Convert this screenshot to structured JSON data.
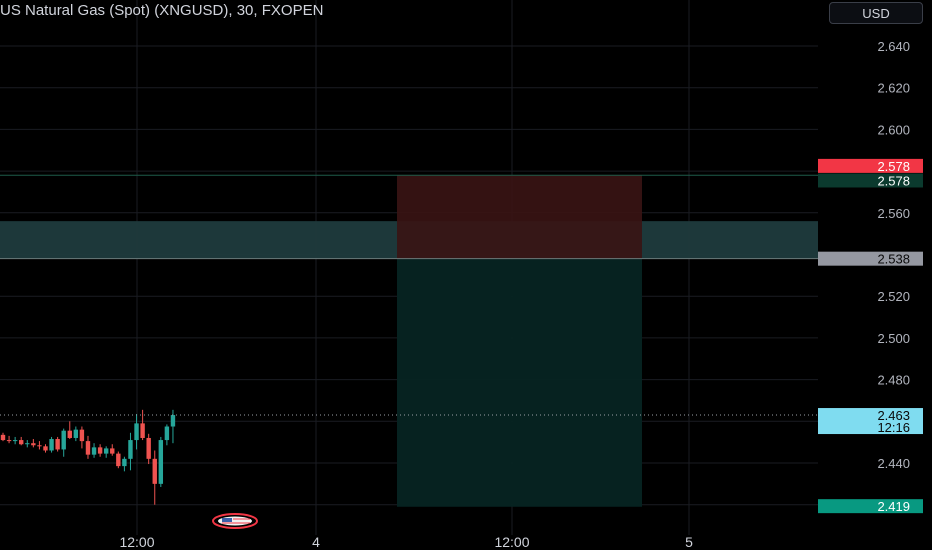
{
  "header": {
    "title": "US Natural Gas (Spot) (XNGUSD), 30, FXOPEN",
    "currency": "USD"
  },
  "colors": {
    "background": "#000000",
    "grid": "#1a1c22",
    "up": "#26a69a",
    "down": "#ef5350",
    "current_price_bg": "#7fdcf0",
    "stop_tag_bg": "#f23645",
    "entry_line_tag_bg": "#0b3a2e",
    "entry_tag_bg": "#9598a1",
    "target_tag_bg": "#089981",
    "zone_fill": "#1f3b3d",
    "risk_fill": "#3a1414",
    "reward_fill": "#062422"
  },
  "chart_data": {
    "type": "candlestick",
    "y_axis": {
      "min": 2.41,
      "max": 2.65,
      "ticks": [
        "2.640",
        "2.620",
        "2.600",
        "2.560",
        "2.520",
        "2.500",
        "2.480",
        "2.440"
      ]
    },
    "x_axis": {
      "ticks": [
        "12:00",
        "4",
        "12:00",
        "5"
      ]
    },
    "candles": [
      {
        "o": 2.4535,
        "h": 2.4545,
        "l": 2.4505,
        "c": 2.451
      },
      {
        "o": 2.451,
        "h": 2.453,
        "l": 2.4495,
        "c": 2.4505
      },
      {
        "o": 2.4505,
        "h": 2.4525,
        "l": 2.449,
        "c": 2.451
      },
      {
        "o": 2.451,
        "h": 2.4525,
        "l": 2.4485,
        "c": 2.449
      },
      {
        "o": 2.449,
        "h": 2.451,
        "l": 2.4475,
        "c": 2.4495
      },
      {
        "o": 2.4495,
        "h": 2.4515,
        "l": 2.4475,
        "c": 2.4485
      },
      {
        "o": 2.4485,
        "h": 2.4505,
        "l": 2.4465,
        "c": 2.448
      },
      {
        "o": 2.448,
        "h": 2.449,
        "l": 2.445,
        "c": 2.446
      },
      {
        "o": 2.446,
        "h": 2.4525,
        "l": 2.445,
        "c": 2.4515
      },
      {
        "o": 2.4515,
        "h": 2.4525,
        "l": 2.4455,
        "c": 2.4465
      },
      {
        "o": 2.4465,
        "h": 2.4565,
        "l": 2.443,
        "c": 2.4555
      },
      {
        "o": 2.4555,
        "h": 2.46,
        "l": 2.4515,
        "c": 2.452
      },
      {
        "o": 2.452,
        "h": 2.4575,
        "l": 2.4505,
        "c": 2.456
      },
      {
        "o": 2.456,
        "h": 2.4575,
        "l": 2.447,
        "c": 2.4505
      },
      {
        "o": 2.4505,
        "h": 2.453,
        "l": 2.442,
        "c": 2.444
      },
      {
        "o": 2.444,
        "h": 2.4495,
        "l": 2.4425,
        "c": 2.4475
      },
      {
        "o": 2.4475,
        "h": 2.449,
        "l": 2.443,
        "c": 2.4445
      },
      {
        "o": 2.4445,
        "h": 2.448,
        "l": 2.4425,
        "c": 2.447
      },
      {
        "o": 2.447,
        "h": 2.449,
        "l": 2.4435,
        "c": 2.4445
      },
      {
        "o": 2.4445,
        "h": 2.4455,
        "l": 2.4375,
        "c": 2.4385
      },
      {
        "o": 2.4385,
        "h": 2.443,
        "l": 2.436,
        "c": 2.442
      },
      {
        "o": 2.442,
        "h": 2.4545,
        "l": 2.4365,
        "c": 2.451
      },
      {
        "o": 2.451,
        "h": 2.4635,
        "l": 2.4465,
        "c": 2.459
      },
      {
        "o": 2.459,
        "h": 2.4655,
        "l": 2.451,
        "c": 2.452
      },
      {
        "o": 2.452,
        "h": 2.454,
        "l": 2.4395,
        "c": 2.442
      },
      {
        "o": 2.442,
        "h": 2.446,
        "l": 2.42,
        "c": 2.43
      },
      {
        "o": 2.43,
        "h": 2.4525,
        "l": 2.4285,
        "c": 2.451
      },
      {
        "o": 2.451,
        "h": 2.4585,
        "l": 2.4485,
        "c": 2.4575
      },
      {
        "o": 2.4575,
        "h": 2.4655,
        "l": 2.4495,
        "c": 2.463
      }
    ],
    "price_lines": {
      "stop": 2.578,
      "entry": 2.538,
      "target": 2.419,
      "current": 2.463
    },
    "zone": {
      "low": 2.538,
      "high": 2.556
    },
    "price_tags": {
      "stop": "2.578",
      "entry_line": "2.578",
      "entry": "2.538",
      "current": "2.463",
      "countdown": "12:16",
      "target": "2.419"
    }
  }
}
